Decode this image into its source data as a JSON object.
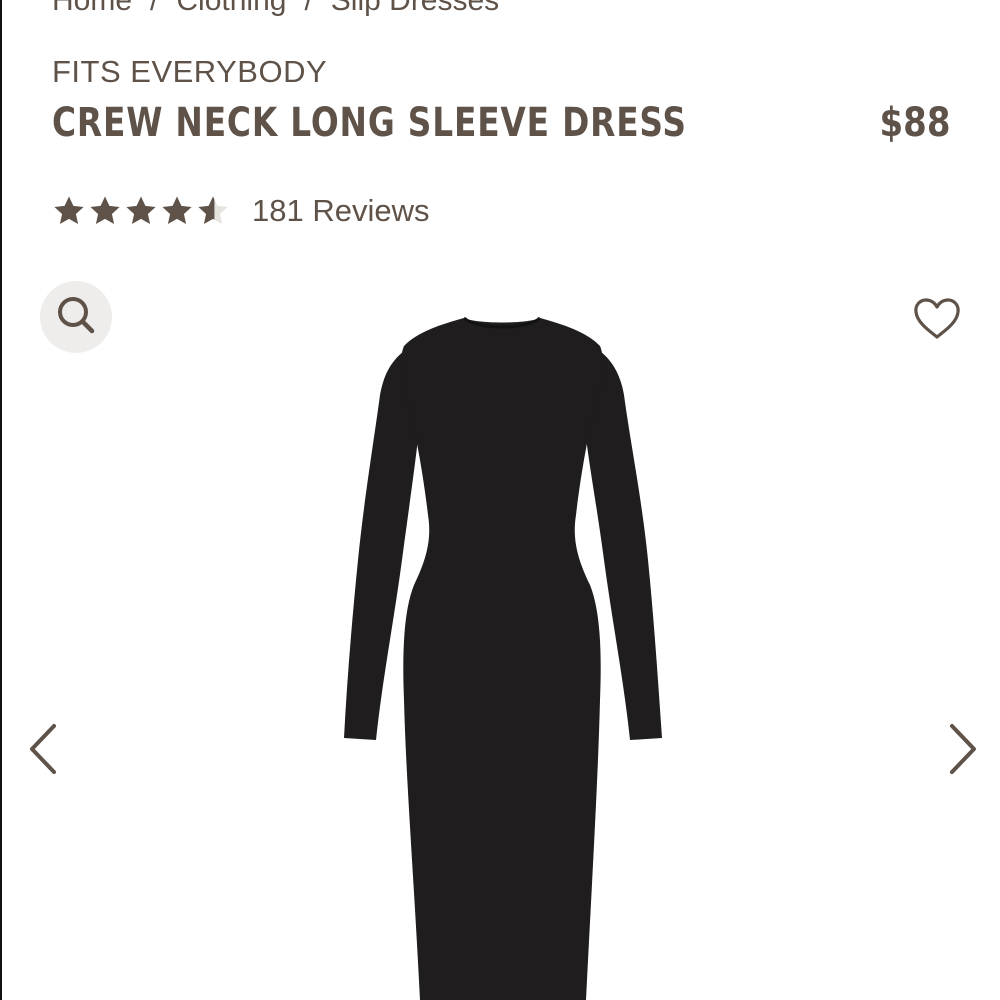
{
  "breadcrumb": {
    "items": [
      "Home",
      "Clothing",
      "Slip Dresses"
    ],
    "separator": "/"
  },
  "product": {
    "collection": "FITS EVERYBODY",
    "title": "CREW NECK LONG SLEEVE DRESS",
    "price": "$88",
    "rating": 4.5,
    "reviews_label": "181 Reviews",
    "image_icon": "black-long-sleeve-dress"
  },
  "icons": {
    "zoom": "search-icon",
    "wishlist": "heart-outline-icon",
    "prev": "chevron-left-icon",
    "next": "chevron-right-icon"
  },
  "colors": {
    "text": "#5e5249",
    "zoom_bg": "#efedeb",
    "dress": "#1f1d1e"
  }
}
